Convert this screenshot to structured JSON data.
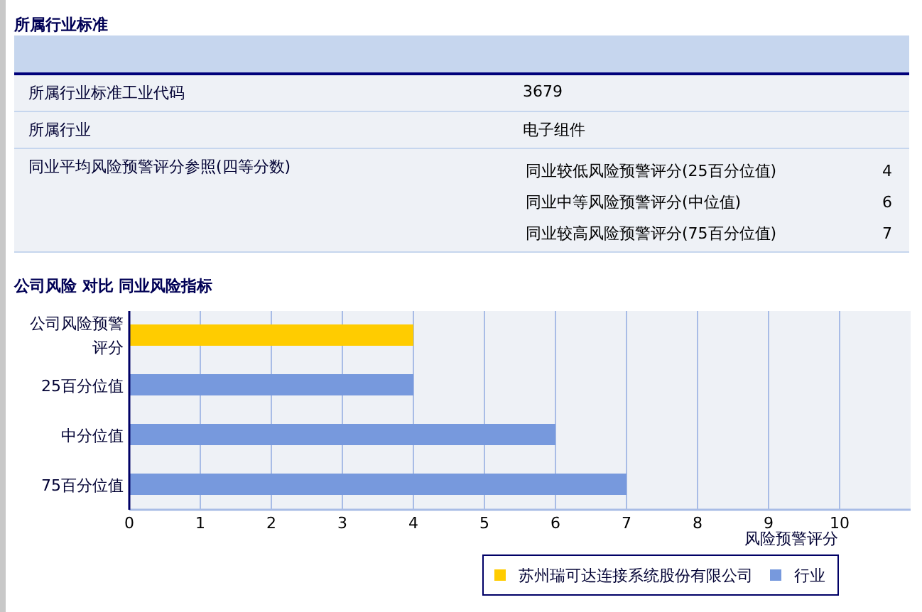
{
  "industry_section": {
    "title": "所属行业标准",
    "rows": [
      {
        "label": "所属行业标准工业代码",
        "value": "3679"
      },
      {
        "label": "所属行业",
        "value": "电子组件"
      },
      {
        "label": "同业平均风险预警评分参照(四等分数)",
        "sub_rows": [
          {
            "label": "同业较低风险预警评分(25百分位值)",
            "value": "4"
          },
          {
            "label": "同业中等风险预警评分(中位值)",
            "value": "6"
          },
          {
            "label": "同业较高风险预警评分(75百分位值)",
            "value": "7"
          }
        ]
      }
    ]
  },
  "chart_section": {
    "title": "公司风险 对比 同业风险指标",
    "chart_data": {
      "type": "bar",
      "orientation": "horizontal",
      "xlabel": "风险预警评分",
      "categories": [
        "公司风险预警评分",
        "25百分位值",
        "中分位值",
        "75百分位值"
      ],
      "series": [
        {
          "name": "苏州瑞可达连接系统股份有限公司",
          "color": "#ffcc00",
          "values": [
            4,
            null,
            null,
            null
          ]
        },
        {
          "name": "行业",
          "color": "#7799dd",
          "values": [
            null,
            4,
            6,
            7
          ]
        }
      ],
      "grid": true,
      "legend": true,
      "xlim": [
        0,
        11
      ],
      "xticks": [
        {
          "value": 0,
          "label": "0"
        },
        {
          "value": 1,
          "label": "1"
        },
        {
          "value": 2,
          "label": "2"
        },
        {
          "value": 3,
          "label": "3"
        },
        {
          "value": 4,
          "label": "4"
        },
        {
          "value": 5,
          "label": "5"
        },
        {
          "value": 6,
          "label": "6"
        },
        {
          "value": 7,
          "label": "7"
        },
        {
          "value": 8,
          "label": "8"
        },
        {
          "value": 9,
          "label": "9"
        },
        {
          "value": 10,
          "label": "10"
        }
      ]
    }
  }
}
